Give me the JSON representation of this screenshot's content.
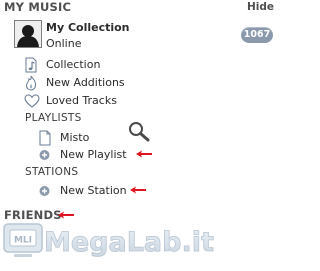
{
  "header": {
    "title": "MY MUSIC",
    "hide_label": "Hide"
  },
  "profile": {
    "name": "My Collection",
    "status": "Online",
    "count_badge": "1067",
    "avatar_icon": "user-silhouette-icon"
  },
  "library": {
    "items": [
      {
        "label": "Collection",
        "icon": "music-note-icon"
      },
      {
        "label": "New Additions",
        "icon": "flame-icon"
      },
      {
        "label": "Loved Tracks",
        "icon": "heart-icon"
      }
    ]
  },
  "playlists": {
    "section_label": "PLAYLISTS",
    "items": [
      {
        "label": "Misto",
        "icon": "document-icon"
      },
      {
        "label": "New Playlist",
        "icon": "plus-circle-icon"
      }
    ]
  },
  "stations": {
    "section_label": "STATIONS",
    "items": [
      {
        "label": "New Station",
        "icon": "plus-circle-icon"
      }
    ]
  },
  "friends": {
    "title": "FRIENDS"
  },
  "annotations": {
    "arrow_color": "#e0141e"
  },
  "watermark": {
    "text": "MegaLab.it"
  },
  "colors": {
    "badge_bg": "#8a9aac",
    "header_text": "#4f4f4f"
  }
}
